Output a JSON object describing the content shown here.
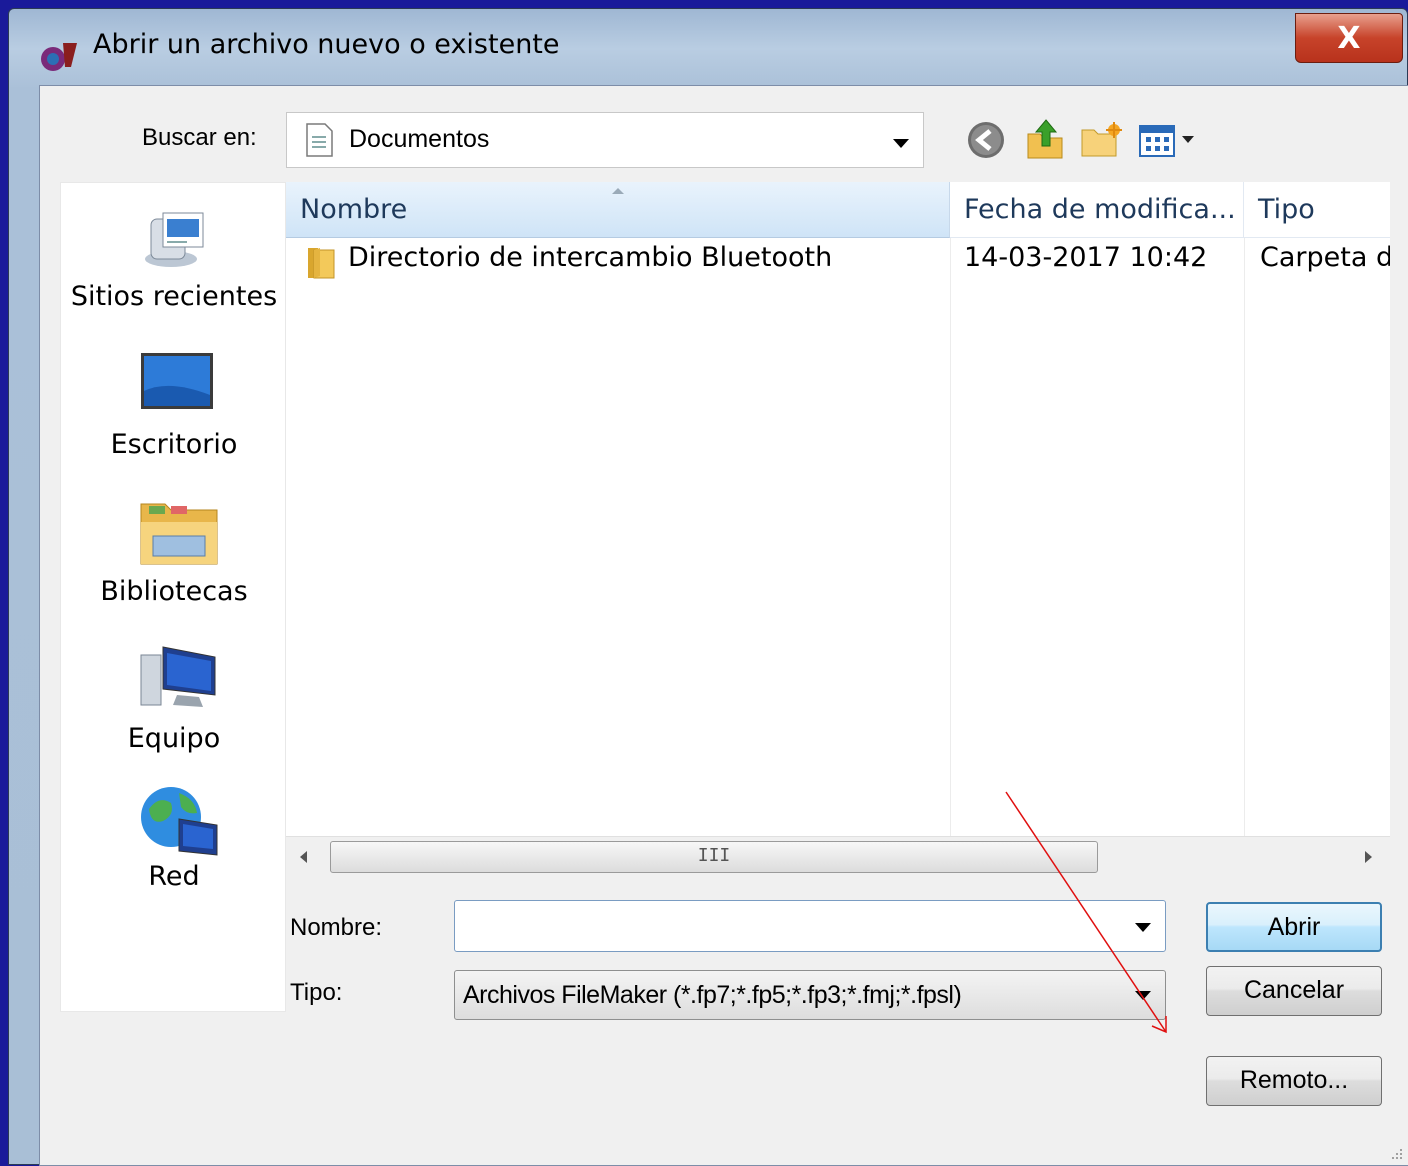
{
  "window": {
    "title": "Abrir un archivo nuevo o existente",
    "close_label": "X"
  },
  "lookin": {
    "label": "Buscar en:",
    "value": "Documentos"
  },
  "toolbar": {
    "icons": [
      "back-icon",
      "up-folder-icon",
      "new-folder-icon",
      "view-menu-icon"
    ]
  },
  "places": [
    {
      "label": "Sitios recientes",
      "icon": "recent-places-icon"
    },
    {
      "label": "Escritorio",
      "icon": "desktop-icon"
    },
    {
      "label": "Bibliotecas",
      "icon": "libraries-icon"
    },
    {
      "label": "Equipo",
      "icon": "computer-icon"
    },
    {
      "label": "Red",
      "icon": "network-icon"
    }
  ],
  "filelist": {
    "columns": [
      "Nombre",
      "Fecha de modifica...",
      "Tipo"
    ],
    "rows": [
      {
        "name": "Directorio de intercambio Bluetooth",
        "date": "14-03-2017 10:42",
        "type": "Carpeta d"
      }
    ],
    "scroll_grip": "III"
  },
  "form": {
    "name_label": "Nombre:",
    "name_value": "",
    "type_label": "Tipo:",
    "type_value": "Archivos FileMaker (*.fp7;*.fp5;*.fp3;*.fmj;*.fpsl)"
  },
  "buttons": {
    "open": "Abrir",
    "cancel": "Cancelar",
    "remote": "Remoto..."
  },
  "colors": {
    "background": "#1a1a9a",
    "annotation_arrow": "#e01010"
  }
}
